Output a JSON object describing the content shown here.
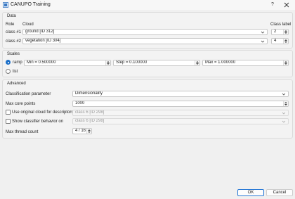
{
  "window": {
    "title": "CANUPO Training",
    "help_label": "?"
  },
  "data_group": {
    "title": "Data",
    "headers": {
      "role": "Role",
      "cloud": "Cloud",
      "class_label": "Class label"
    },
    "rows": [
      {
        "role": "class #1",
        "cloud": "ground [ID 312]",
        "label": "2"
      },
      {
        "role": "class #2",
        "cloud": "vegetation [ID 304]",
        "label": "4"
      }
    ]
  },
  "scales_group": {
    "title": "Scales",
    "ramp_label": "ramp",
    "list_label": "list",
    "mode": "ramp",
    "min": "Min = 0.500000",
    "step": "Step = 0.100000",
    "max": "Max = 1.000000"
  },
  "advanced_group": {
    "title": "Advanced",
    "classification_parameter_label": "Classification parameter",
    "classification_parameter_value": "Dimensionality",
    "max_core_points_label": "Max core points",
    "max_core_points_value": "1000",
    "use_original_cloud_label": "Use original cloud for descriptors",
    "use_original_cloud_value": "class 6 [ID 298]",
    "use_original_cloud_checked": false,
    "show_classifier_label": "Show classifier behavior on",
    "show_classifier_value": "class 6 [ID 298]",
    "show_classifier_checked": false,
    "max_thread_count_label": "Max thread count",
    "max_thread_count_value": "4 / 16"
  },
  "footer": {
    "ok_label": "OK",
    "cancel_label": "Cancel"
  },
  "colors": {
    "accent": "#1b6fc8",
    "background": "#f0f0f0"
  }
}
